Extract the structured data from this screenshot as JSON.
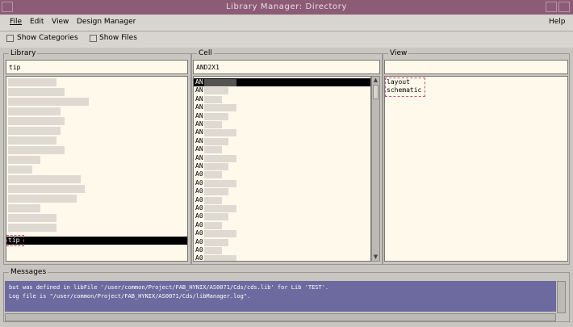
{
  "window": {
    "title": "Library Manager: Directory",
    "title_color": "#8c5b76"
  },
  "menu": {
    "file": "File",
    "edit": "Edit",
    "view": "View",
    "design_manager": "Design Manager",
    "help": "Help"
  },
  "toolbar": {
    "show_categories": "Show Categories",
    "show_files": "Show Files"
  },
  "library": {
    "label": "Library",
    "filter_value": "tip",
    "selected": "tip"
  },
  "cell": {
    "label": "Cell",
    "filter_value": "AND2X1",
    "items": [
      "AN",
      "AN",
      "AN",
      "AN",
      "AN",
      "AN",
      "AN",
      "AN",
      "AN",
      "AN",
      "AN",
      "A0",
      "A0",
      "A0",
      "A0",
      "A0",
      "A0",
      "A0",
      "A0",
      "A0",
      "A0",
      "A0"
    ]
  },
  "view": {
    "label": "View",
    "filter_value": "",
    "items": [
      "layout",
      "schematic"
    ]
  },
  "messages": {
    "label": "Messages",
    "lines": [
      "        but was defined in libFile '/user/common/Project/FAB_HYNIX/AS0071/Cds/cds.lib' for Lib 'TEST'.",
      "Log file is \"/user/common/Project/FAB_HYNIX/AS0071/Cds/libManager.log\"."
    ],
    "background": "#6d6a9f"
  },
  "colors": {
    "list_bg": "#fff9ec",
    "panel_bg": "#c9c5c0",
    "selection": "#000000"
  }
}
